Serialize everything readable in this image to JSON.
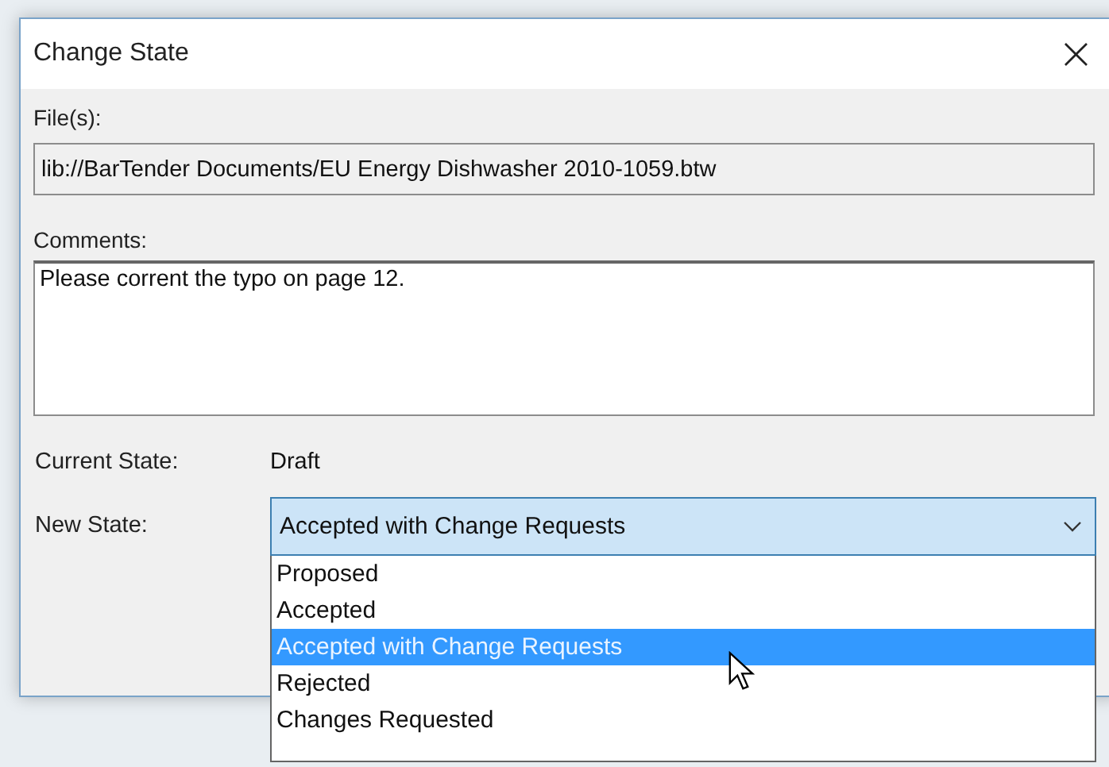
{
  "window": {
    "title": "Change State",
    "close": "×"
  },
  "files": {
    "label": "File(s):",
    "value": "lib://BarTender Documents/EU Energy Dishwasher 2010-1059.btw"
  },
  "comments": {
    "label": "Comments:",
    "value": "Please corrent the typo on page 12."
  },
  "current_state": {
    "label": "Current State:",
    "value": "Draft"
  },
  "new_state": {
    "label": "New State:",
    "value": "Accepted with Change Requests",
    "expanded": true,
    "options": [
      {
        "label": "Proposed",
        "selected": false
      },
      {
        "label": "Accepted",
        "selected": false
      },
      {
        "label": "Accepted with Change Requests",
        "selected": true
      },
      {
        "label": "Rejected",
        "selected": false
      },
      {
        "label": "Changes Requested",
        "selected": false
      }
    ]
  }
}
